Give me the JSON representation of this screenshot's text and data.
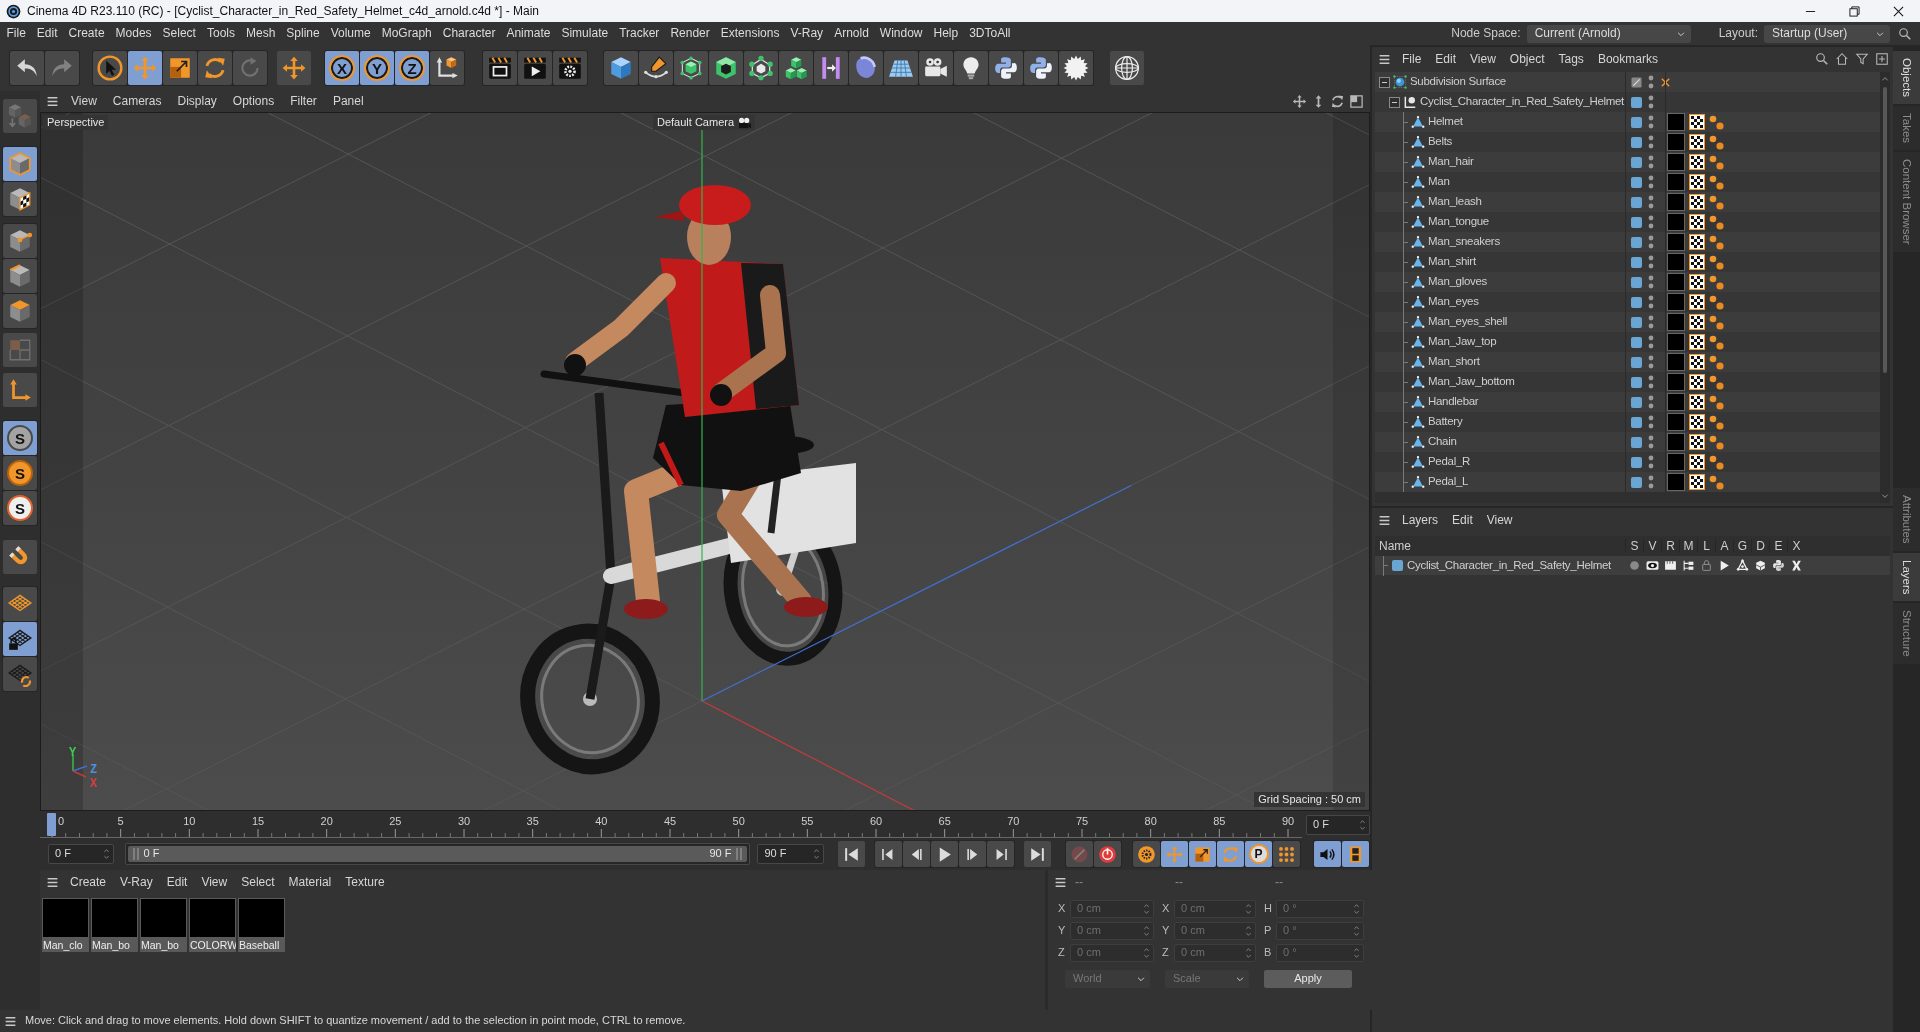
{
  "window": {
    "title": "Cinema 4D R23.110 (RC) - [Cyclist_Character_in_Red_Safety_Helmet_c4d_arnold.c4d *] - Main"
  },
  "menu_bar": {
    "items": [
      "File",
      "Edit",
      "Create",
      "Modes",
      "Select",
      "Tools",
      "Mesh",
      "Spline",
      "Volume",
      "MoGraph",
      "Character",
      "Animate",
      "Simulate",
      "Tracker",
      "Render",
      "Extensions",
      "V-Ray",
      "Arnold",
      "Window",
      "Help",
      "3DToAll"
    ],
    "node_space": {
      "label": "Node Space:",
      "value": "Current (Arnold)"
    },
    "layout": {
      "label": "Layout:",
      "value": "Startup (User)"
    }
  },
  "toolbar": {
    "buttons": [
      {
        "selected": false,
        "disabled": false
      },
      {
        "selected": false,
        "disabled": true
      },
      {
        "selected": false,
        "disabled": false
      },
      {
        "selected": true,
        "disabled": false
      },
      {
        "selected": false,
        "disabled": false
      },
      {
        "selected": false,
        "disabled": false
      },
      {
        "selected": false,
        "disabled": true
      },
      {
        "selected": false,
        "disabled": false
      },
      {
        "label": "X",
        "selected": true,
        "disabled": false
      },
      {
        "label": "Y",
        "selected": true,
        "disabled": false
      },
      {
        "label": "Z",
        "selected": true,
        "disabled": false
      },
      {
        "selected": false,
        "disabled": false
      },
      {
        "selected": false,
        "disabled": false
      },
      {
        "selected": false,
        "disabled": false
      },
      {
        "selected": false,
        "disabled": false
      },
      {
        "selected": false,
        "disabled": false
      },
      {
        "selected": false,
        "disabled": false
      },
      {
        "selected": false,
        "disabled": false
      },
      {
        "selected": false,
        "disabled": false
      },
      {
        "selected": false,
        "disabled": false
      },
      {
        "selected": false,
        "disabled": false
      },
      {
        "selected": false,
        "disabled": false
      },
      {
        "selected": false,
        "disabled": false
      },
      {
        "selected": false,
        "disabled": false
      },
      {
        "selected": false,
        "disabled": false
      },
      {
        "selected": false,
        "disabled": false
      },
      {
        "selected": false,
        "disabled": false
      },
      {
        "selected": false,
        "disabled": false
      },
      {
        "selected": false,
        "disabled": false
      },
      {
        "selected": false,
        "disabled": false
      }
    ]
  },
  "mode_toolbar": {
    "buttons": [
      {
        "selected": false,
        "disabled": true
      },
      {
        "selected": true,
        "disabled": false
      },
      {
        "selected": false,
        "disabled": false
      },
      {
        "selected": false,
        "disabled": false
      },
      {
        "selected": false,
        "disabled": false
      },
      {
        "selected": false,
        "disabled": false
      },
      {
        "selected": false,
        "disabled": true
      },
      {
        "selected": false,
        "disabled": false
      },
      {
        "label": "S",
        "selected": true,
        "disabled": false
      },
      {
        "label": "S",
        "selected": false,
        "disabled": false
      },
      {
        "label": "S",
        "selected": false,
        "disabled": false
      },
      {
        "selected": false,
        "disabled": false
      },
      {
        "selected": false,
        "disabled": false
      },
      {
        "selected": true,
        "disabled": false
      },
      {
        "selected": false,
        "disabled": false
      }
    ]
  },
  "viewport": {
    "menu": [
      "View",
      "Cameras",
      "Display",
      "Options",
      "Filter",
      "Panel"
    ],
    "view_name": "Perspective",
    "camera": "Default Camera",
    "grid_spacing": "Grid Spacing : 50 cm",
    "axis_gizmo": [
      {
        "label": "Y",
        "color": "#3ccf4e"
      },
      {
        "label": "Z",
        "color": "#4a8fe8"
      },
      {
        "label": "X",
        "color": "#d64040"
      }
    ]
  },
  "timeline": {
    "ticks": [
      "0",
      "5",
      "10",
      "15",
      "20",
      "25",
      "30",
      "35",
      "40",
      "45",
      "50",
      "55",
      "60",
      "65",
      "70",
      "75",
      "80",
      "85",
      "90"
    ],
    "level": 0,
    "current_frame": "0 F"
  },
  "playback": {
    "start_field": "0 F",
    "range_slider": {
      "start": "0 F",
      "end": "90 F",
      "level": 1
    },
    "end_field": "90 F",
    "buttons": [
      {
        "selected": false,
        "disabled": false
      },
      {
        "selected": false,
        "disabled": false
      },
      {
        "selected": false,
        "disabled": false
      },
      {
        "selected": false,
        "disabled": false
      },
      {
        "selected": false,
        "disabled": false
      },
      {
        "selected": false,
        "disabled": false
      },
      {
        "selected": false,
        "disabled": false
      },
      {
        "selected": false,
        "disabled": true
      },
      {
        "selected": false,
        "disabled": false
      },
      {
        "selected": false,
        "disabled": false
      },
      {
        "selected": true,
        "disabled": false
      },
      {
        "selected": true,
        "disabled": false
      },
      {
        "selected": true,
        "disabled": false
      },
      {
        "label": "P",
        "selected": true,
        "disabled": false
      },
      {
        "selected": false,
        "disabled": false
      },
      {
        "selected": true,
        "disabled": false
      },
      {
        "selected": true,
        "disabled": false
      }
    ]
  },
  "material_manager": {
    "menu": [
      "Create",
      "V-Ray",
      "Edit",
      "View",
      "Select",
      "Material",
      "Texture"
    ],
    "materials": [
      {
        "name": "Man_clo"
      },
      {
        "name": "Man_bo"
      },
      {
        "name": "Man_bo"
      },
      {
        "name": "COLORW"
      },
      {
        "name": "Baseball"
      }
    ]
  },
  "coordinates": {
    "headers": [
      "--",
      "--",
      "--"
    ],
    "rows": [
      {
        "cells": [
          "X",
          "0 cm",
          "X",
          "0 cm",
          "H",
          "0 °"
        ]
      },
      {
        "cells": [
          "Y",
          "0 cm",
          "Y",
          "0 cm",
          "P",
          "0 °"
        ]
      },
      {
        "cells": [
          "Z",
          "0 cm",
          "Z",
          "0 cm",
          "B",
          "0 °"
        ]
      }
    ],
    "space": "World",
    "mode": "Scale",
    "apply": "Apply"
  },
  "status_bar": {
    "text": "Move: Click and drag to move elements. Hold down SHIFT to quantize movement / add to the selection in point mode, CTRL to remove."
  },
  "object_manager": {
    "menu": [
      "File",
      "Edit",
      "View",
      "Object",
      "Tags",
      "Bookmarks"
    ],
    "objects": [
      {
        "name": "Subdivision Surface",
        "kind": "generator",
        "expanded": true,
        "in_layer": false,
        "enabled": false,
        "tagged": false,
        "children": [
          {
            "name": "Cyclist_Character_in_Red_Safety_Helmet",
            "kind": "null",
            "expanded": true,
            "in_layer": true,
            "tagged": false,
            "children": [
              {
                "name": "Helmet",
                "kind": "polygon",
                "in_layer": true,
                "tagged": true
              },
              {
                "name": "Belts",
                "kind": "polygon",
                "in_layer": true,
                "tagged": true
              },
              {
                "name": "Man_hair",
                "kind": "polygon",
                "in_layer": true,
                "tagged": true
              },
              {
                "name": "Man",
                "kind": "polygon",
                "in_layer": true,
                "tagged": true
              },
              {
                "name": "Man_leash",
                "kind": "polygon",
                "in_layer": true,
                "tagged": true
              },
              {
                "name": "Man_tongue",
                "kind": "polygon",
                "in_layer": true,
                "tagged": true
              },
              {
                "name": "Man_sneakers",
                "kind": "polygon",
                "in_layer": true,
                "tagged": true
              },
              {
                "name": "Man_shirt",
                "kind": "polygon",
                "in_layer": true,
                "tagged": true
              },
              {
                "name": "Man_gloves",
                "kind": "polygon",
                "in_layer": true,
                "tagged": true
              },
              {
                "name": "Man_eyes",
                "kind": "polygon",
                "in_layer": true,
                "tagged": true
              },
              {
                "name": "Man_eyes_shell",
                "kind": "polygon",
                "in_layer": true,
                "tagged": true
              },
              {
                "name": "Man_Jaw_top",
                "kind": "polygon",
                "in_layer": true,
                "tagged": true
              },
              {
                "name": "Man_short",
                "kind": "polygon",
                "in_layer": true,
                "tagged": true
              },
              {
                "name": "Man_Jaw_bottom",
                "kind": "polygon",
                "in_layer": true,
                "tagged": true
              },
              {
                "name": "Handlebar",
                "kind": "polygon",
                "in_layer": true,
                "tagged": true
              },
              {
                "name": "Battery",
                "kind": "polygon",
                "in_layer": true,
                "tagged": true
              },
              {
                "name": "Chain",
                "kind": "polygon",
                "in_layer": true,
                "tagged": true
              },
              {
                "name": "Pedal_R",
                "kind": "polygon",
                "in_layer": true,
                "tagged": true
              },
              {
                "name": "Pedal_L",
                "kind": "polygon",
                "in_layer": true,
                "tagged": true
              }
            ]
          }
        ]
      }
    ]
  },
  "layer_manager": {
    "menu": [
      "Layers",
      "Edit",
      "View"
    ],
    "columns": [
      "Name",
      "S",
      "V",
      "R",
      "M",
      "L",
      "A",
      "G",
      "D",
      "E",
      "X"
    ],
    "layers": [
      {
        "name": "Cyclist_Character_in_Red_Safety_Helmet",
        "color": "#6aa6d4"
      }
    ]
  },
  "side_tabs": {
    "upper": [
      {
        "label": "Objects",
        "selected": true
      },
      {
        "label": "Takes",
        "selected": false
      },
      {
        "label": "Content Browser",
        "selected": false
      }
    ],
    "lower": [
      {
        "label": "Attributes",
        "selected": false
      },
      {
        "label": "Layers",
        "selected": true
      },
      {
        "label": "Structure",
        "selected": false
      }
    ]
  }
}
